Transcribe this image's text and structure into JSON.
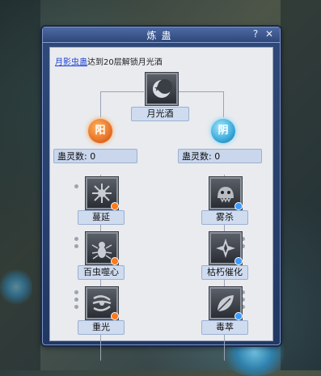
{
  "window": {
    "title": "炼蛊",
    "help_label": "?",
    "close_label": "✕"
  },
  "unlock_tip": {
    "link_text": "月影虫蛊",
    "rest_text": "达到20层解锁月光酒"
  },
  "top_skill": {
    "name": "月光酒",
    "icon": "crescent-moon-icon"
  },
  "branches": [
    {
      "orb_label": "阳",
      "orb_color": "#e8742a",
      "count_text": "蛊灵数: 0",
      "skills": [
        {
          "name": "蔓延",
          "icon": "spore-icon",
          "badge_color": "#ff7a1a"
        },
        {
          "name": "百虫噬心",
          "icon": "insect-icon",
          "badge_color": "#ff7a1a"
        },
        {
          "name": "重光",
          "icon": "tentacle-icon",
          "badge_color": "#ff7a1a"
        }
      ]
    },
    {
      "orb_label": "阴",
      "orb_color": "#3aa9d9",
      "count_text": "蛊灵数: 0",
      "skills": [
        {
          "name": "雾杀",
          "icon": "beast-icon",
          "badge_color": "#3a9cff"
        },
        {
          "name": "枯朽催化",
          "icon": "cross-blade-icon",
          "badge_color": "#3a9cff"
        },
        {
          "name": "毒萃",
          "icon": "leaf-icon",
          "badge_color": "#3a9cff"
        }
      ]
    }
  ]
}
